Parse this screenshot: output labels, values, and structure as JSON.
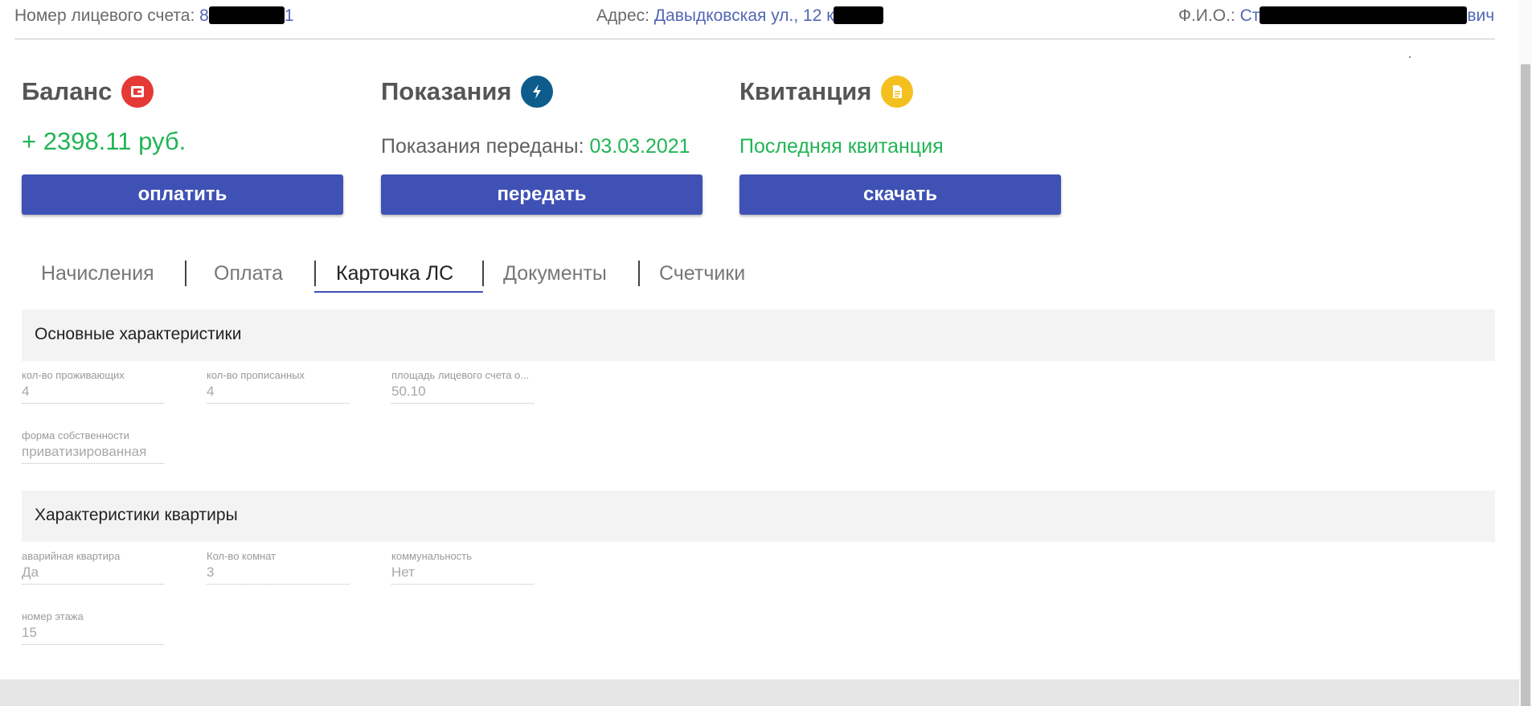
{
  "header": {
    "account_label": "Номер лицевого счета:",
    "account_prefix": "8",
    "account_suffix": "1",
    "address_label": "Адрес:",
    "address_value": "Давыдковская ул., 12 к",
    "fio_label": "Ф.И.О.:",
    "fio_prefix": "Ст",
    "fio_suffix": "вич"
  },
  "cards": {
    "balance": {
      "title": "Баланс",
      "value": "+ 2398.11 руб.",
      "button": "оплатить",
      "icon_color": "#e53935"
    },
    "readings": {
      "title": "Показания",
      "info_label": "Показания переданы:",
      "info_date": "03.03.2021",
      "button": "передать",
      "icon_color": "#0d5c8c"
    },
    "receipt": {
      "title": "Квитанция",
      "link": "Последняя квитанция",
      "button": "скачать",
      "icon_color": "#f4c020"
    }
  },
  "tabs": [
    "Начисления",
    "Оплата",
    "Карточка ЛС",
    "Документы",
    "Счетчики"
  ],
  "active_tab": "Карточка ЛС",
  "sections": {
    "main": {
      "title": "Основные характеристики",
      "fields": [
        {
          "label": "кол-во проживающих",
          "value": "4"
        },
        {
          "label": "кол-во прописанных",
          "value": "4"
        },
        {
          "label": "площадь лицевого счета о...",
          "value": "50.10"
        },
        {
          "label": "форма собственности",
          "value": "приватизированная"
        }
      ]
    },
    "flat": {
      "title": "Характеристики квартиры",
      "fields": [
        {
          "label": "аварийная квартира",
          "value": "Да"
        },
        {
          "label": "Кол-во комнат",
          "value": "3"
        },
        {
          "label": "коммунальность",
          "value": "Нет"
        },
        {
          "label": "номер этажа",
          "value": "15"
        }
      ]
    }
  },
  "colors": {
    "accent": "#3f51b5",
    "green": "#22b455",
    "link": "#5366b4"
  }
}
